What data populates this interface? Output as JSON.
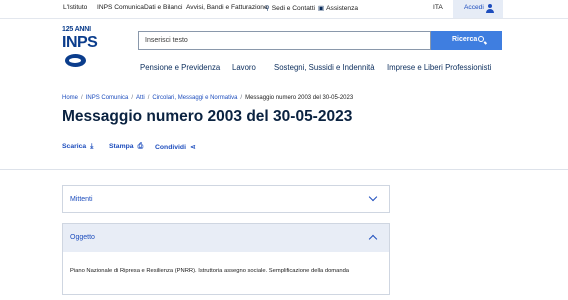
{
  "topbar": {
    "links": [
      {
        "label": "L'Istituto"
      },
      {
        "label": "INPS Comunica"
      },
      {
        "label": "Dati e Bilanci"
      },
      {
        "label": "Avvisi, Bandi e Fatturazione"
      },
      {
        "label": "Sedi e Contatti",
        "icon": "location-pin-icon"
      },
      {
        "label": "Assistenza",
        "icon": "chat-icon"
      }
    ],
    "language": "ITA",
    "login_label": "Accedi"
  },
  "logo": {
    "anni": "125 ANNI",
    "name": "INPS"
  },
  "search": {
    "placeholder": "Inserisci testo",
    "button_label": "Ricerca"
  },
  "main_nav": [
    {
      "label": "Pensione e Previdenza"
    },
    {
      "label": "Lavoro"
    },
    {
      "label": "Sostegni, Sussidi e Indennità"
    },
    {
      "label": "Imprese e Liberi Professionisti"
    }
  ],
  "breadcrumb": [
    {
      "label": "Home"
    },
    {
      "label": "INPS Comunica"
    },
    {
      "label": "Atti"
    },
    {
      "label": "Circolari, Messaggi e Normativa"
    },
    {
      "label": "Messaggio numero 2003 del 30-05-2023"
    }
  ],
  "page_title": "Messaggio numero 2003 del 30-05-2023",
  "actions": [
    {
      "label": "Scarica",
      "icon": "download-icon"
    },
    {
      "label": "Stampa",
      "icon": "print-icon"
    },
    {
      "label": "Condividi",
      "icon": "share-icon"
    }
  ],
  "accordions": [
    {
      "title": "Mittenti",
      "expanded": false
    },
    {
      "title": "Oggetto",
      "expanded": true,
      "content": "Piano Nazionale di Ripresa e Resilienza (PNRR). Istruttoria assegno sociale. Semplificazione della domanda"
    }
  ],
  "colors": {
    "primary": "#3f7ee0",
    "link": "#1d4dbd",
    "title": "#0a2240",
    "accent_bg": "#e6ecf6"
  }
}
